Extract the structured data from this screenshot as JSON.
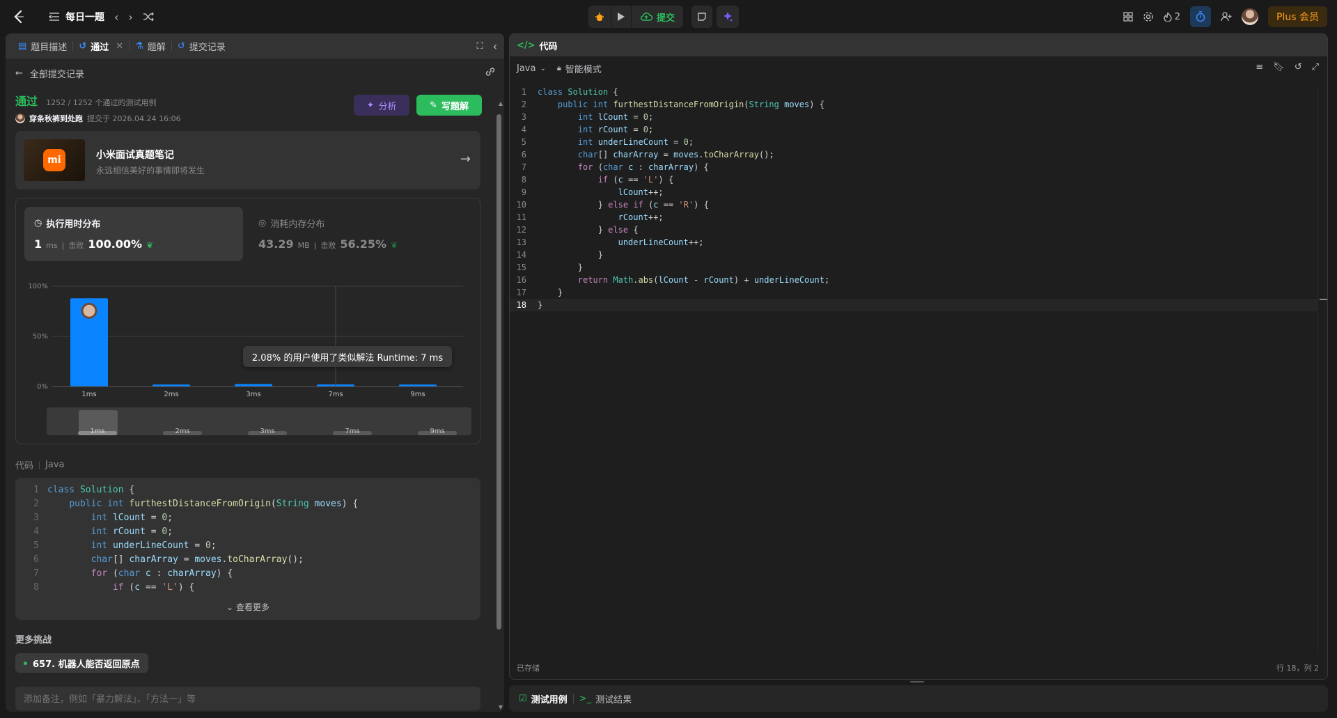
{
  "topbar": {
    "problem_list_label": "每日一题",
    "submit_label": "提交",
    "streak_count": "2",
    "plus_label": "Plus 会员"
  },
  "left": {
    "tabs": [
      {
        "label": "题目描述"
      },
      {
        "label": "通过"
      },
      {
        "label": "题解"
      },
      {
        "label": "提交记录"
      }
    ],
    "back_label": "全部提交记录",
    "status": "通过",
    "cases": "1252 / 1252 个通过的测试用例",
    "user": "穿条秋裤到处跑",
    "submitted_at": "提交于 2026.04.24 16:06",
    "analyze_label": "分析",
    "write_label": "写题解",
    "promo_title": "小米面试真题笔记",
    "promo_sub": "永远相信美好的事情即将发生",
    "promo_logo": "mi",
    "runtime": {
      "title": "执行用时分布",
      "value": "1",
      "unit": "ms",
      "beat_label": "击败",
      "pct": "100.00%"
    },
    "memory": {
      "title": "消耗内存分布",
      "value": "43.29",
      "unit": "MB",
      "beat_label": "击败",
      "pct": "56.25%"
    },
    "tooltip": "2.08% 的用户使用了类似解法 Runtime: 7 ms",
    "code_label": "代码",
    "lang_label": "Java",
    "see_more": "查看更多",
    "more_title": "更多挑战",
    "challenge": "657. 机器人能否返回原点",
    "note_placeholder": "添加备注，例如「暴力解法」、「方法一」等"
  },
  "chart_data": {
    "type": "bar",
    "categories": [
      "1ms",
      "2ms",
      "3ms",
      "7ms",
      "9ms"
    ],
    "values": [
      88,
      2,
      2.5,
      2.08,
      2
    ],
    "ylim": [
      0,
      100
    ],
    "yticks": [
      "0%",
      "50%",
      "100%"
    ],
    "highlight": "1ms",
    "bar_color": "#0a84ff"
  },
  "right": {
    "tab_label": "代码",
    "lang": "Java",
    "mode": "智能模式",
    "saved": "已存储",
    "cursor": "行 18，列 2"
  },
  "bottom": {
    "tab1": "测试用例",
    "tab2": "测试结果"
  },
  "code_lines": [
    "class Solution {",
    "    public int furthestDistanceFromOrigin(String moves) {",
    "        int lCount = 0;",
    "        int rCount = 0;",
    "        int underLineCount = 0;",
    "        char[] charArray = moves.toCharArray();",
    "        for (char c : charArray) {",
    "            if (c == 'L') {",
    "                lCount++;",
    "            } else if (c == 'R') {",
    "                rCount++;",
    "            } else {",
    "                underLineCount++;",
    "            }",
    "        }",
    "        return Math.abs(lCount - rCount) + underLineCount;",
    "    }",
    "}"
  ]
}
